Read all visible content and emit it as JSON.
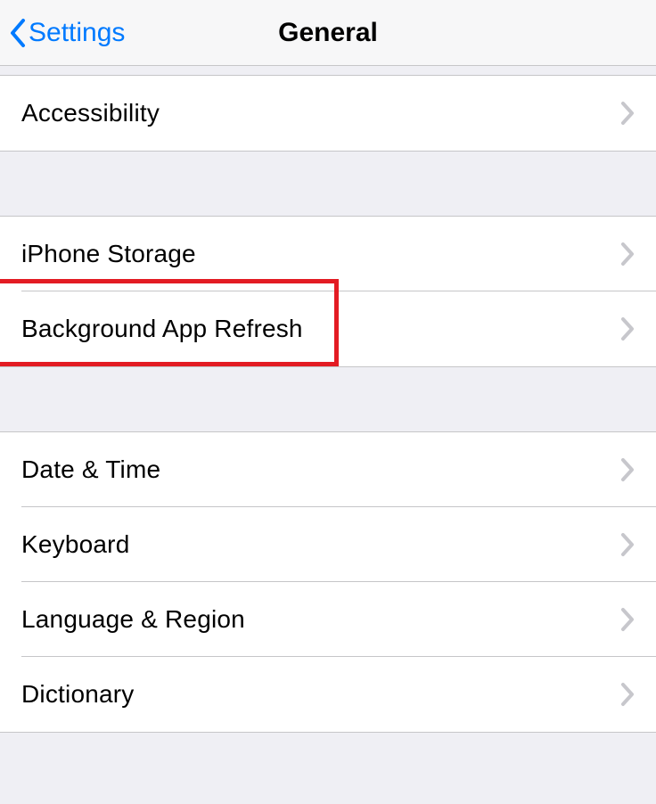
{
  "nav": {
    "back_label": "Settings",
    "title": "General"
  },
  "groups": [
    {
      "id": "accessibility",
      "items": [
        {
          "id": "accessibility",
          "label": "Accessibility"
        }
      ]
    },
    {
      "id": "storage",
      "items": [
        {
          "id": "iphone-storage",
          "label": "iPhone Storage"
        },
        {
          "id": "background-app-refresh",
          "label": "Background App Refresh"
        }
      ]
    },
    {
      "id": "system",
      "items": [
        {
          "id": "date-time",
          "label": "Date & Time"
        },
        {
          "id": "keyboard",
          "label": "Keyboard"
        },
        {
          "id": "language-region",
          "label": "Language & Region"
        },
        {
          "id": "dictionary",
          "label": "Dictionary"
        }
      ]
    }
  ],
  "highlight": {
    "item_id": "background-app-refresh"
  }
}
